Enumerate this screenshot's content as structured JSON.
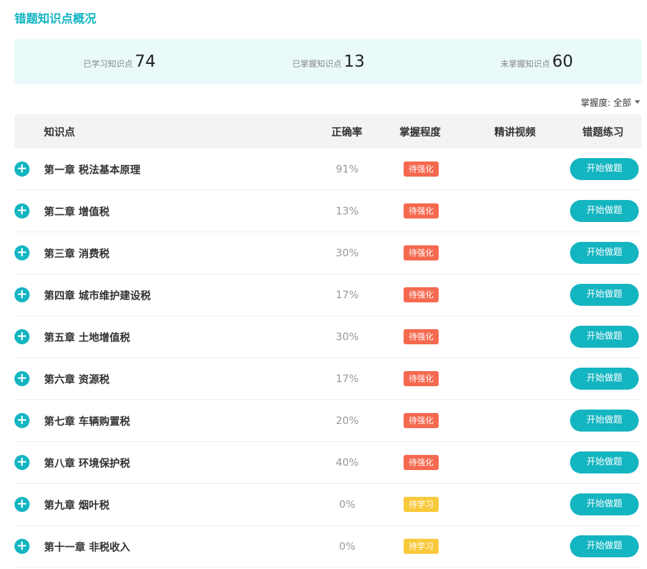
{
  "page_title": "错题知识点概况",
  "stats": [
    {
      "label": "已学习知识点",
      "value": "74"
    },
    {
      "label": "已掌握知识点",
      "value": "13"
    },
    {
      "label": "未掌握知识点",
      "value": "60"
    }
  ],
  "filter": {
    "label": "掌握度:",
    "value": "全部"
  },
  "table": {
    "headers": {
      "topic": "知识点",
      "accuracy": "正确率",
      "mastery": "掌握程度",
      "video": "精讲视频",
      "practice": "错题练习"
    },
    "rows": [
      {
        "topic": "第一章 税法基本原理",
        "accuracy": "91%",
        "mastery": "待强化",
        "action": "开始做题"
      },
      {
        "topic": "第二章 增值税",
        "accuracy": "13%",
        "mastery": "待强化",
        "action": "开始做题"
      },
      {
        "topic": "第三章 消费税",
        "accuracy": "30%",
        "mastery": "待强化",
        "action": "开始做题"
      },
      {
        "topic": "第四章 城市维护建设税",
        "accuracy": "17%",
        "mastery": "待强化",
        "action": "开始做题"
      },
      {
        "topic": "第五章 土地增值税",
        "accuracy": "30%",
        "mastery": "待强化",
        "action": "开始做题"
      },
      {
        "topic": "第六章 资源税",
        "accuracy": "17%",
        "mastery": "待强化",
        "action": "开始做题"
      },
      {
        "topic": "第七章 车辆购置税",
        "accuracy": "20%",
        "mastery": "待强化",
        "action": "开始做题"
      },
      {
        "topic": "第八章 环境保护税",
        "accuracy": "40%",
        "mastery": "待强化",
        "action": "开始做题"
      },
      {
        "topic": "第九章 烟叶税",
        "accuracy": "0%",
        "mastery": "待学习",
        "action": "开始做题"
      },
      {
        "topic": "第十一章 非税收入",
        "accuracy": "0%",
        "mastery": "待学习",
        "action": "开始做题"
      }
    ]
  },
  "colors": {
    "accent": "#13b5c1",
    "badge_strengthen": "#f5694f",
    "badge_learn": "#f9c93c",
    "stats_bg": "#eafafb"
  },
  "icons": {
    "expand": "plus-circle-icon",
    "dropdown": "caret-down-icon"
  }
}
